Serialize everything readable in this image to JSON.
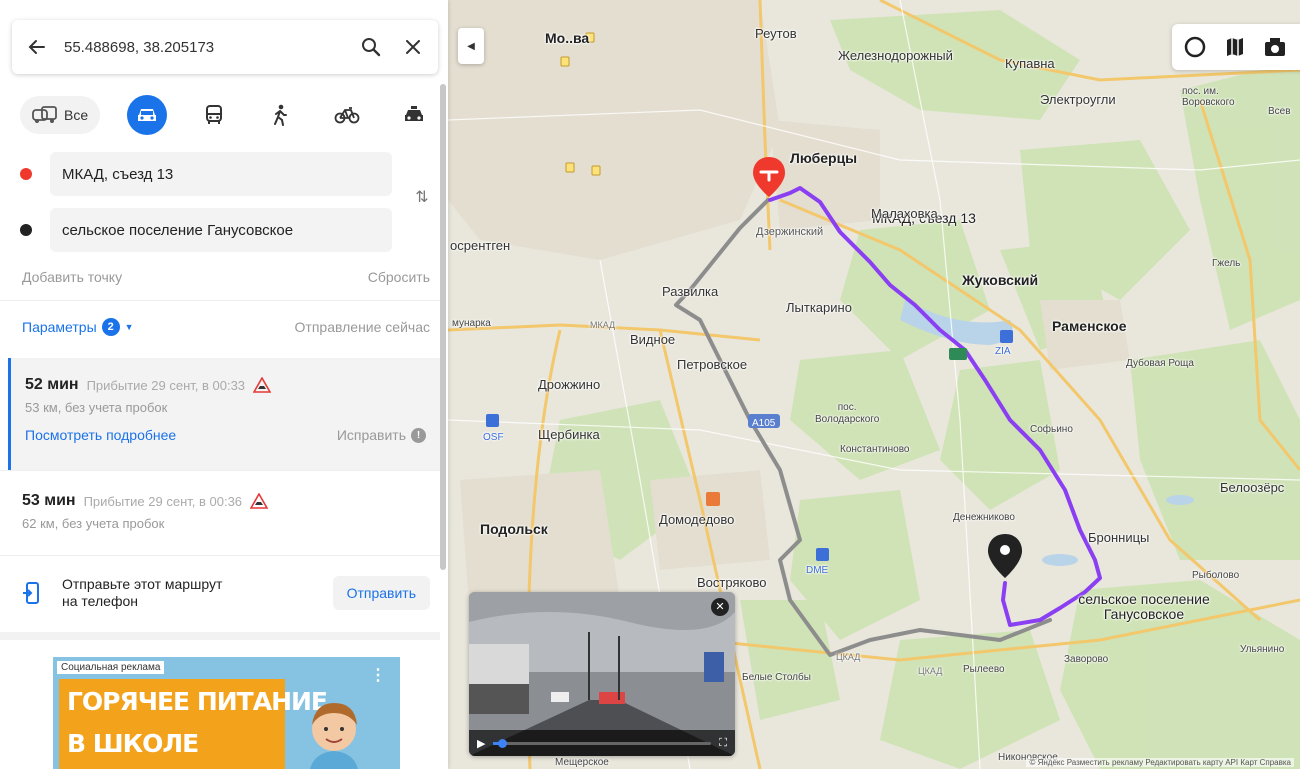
{
  "search": {
    "value": "55.488698, 38.205173"
  },
  "modes": {
    "all_label": "Все"
  },
  "route_points": {
    "from": "МКАД, съезд 13",
    "to": "сельское поселение Ганусовское",
    "add_point": "Добавить точку",
    "reset": "Сбросить"
  },
  "params": {
    "label": "Параметры",
    "count": "2",
    "departure": "Отправление сейчас"
  },
  "routes": [
    {
      "time": "52 мин",
      "arrival": "Прибытие 29 сент, в 00:33",
      "details": "53 км, без учета пробок",
      "more": "Посмотреть подробнее",
      "fix": "Исправить"
    },
    {
      "time": "53 мин",
      "arrival": "Прибытие 29 сент, в 00:36",
      "details": "62 км, без учета пробок"
    }
  ],
  "send": {
    "text_line1": "Отправьте этот маршрут",
    "text_line2": "на телефон",
    "button": "Отправить"
  },
  "ad": {
    "tag": "Социальная реклама",
    "line1": "ГОРЯЧЕЕ ПИТАНИЕ",
    "line2": "В ШКОЛЕ"
  },
  "map": {
    "labels": {
      "moskva": "Мо..ва",
      "reutov": "Реутов",
      "zheleznodorozhny": "Железнодорожный",
      "kupavna": "Купавна",
      "elektrougli": "Электроугли",
      "pos_vorovskogo": "пос. им.\nВоровского",
      "vse": "Всев",
      "lyubertsy": "Люберцы",
      "mkad_exit": "МКАД, съезд 13",
      "dzerzhinsky": "Дзержинский",
      "malakhovka": "Малаховка",
      "rentgen": "осрентген",
      "zhukovsky": "Жуковский",
      "gzhel": "Гжель",
      "razvilka": "Развилка",
      "lytkarino": "Лыткарино",
      "munarka": "мунарка",
      "mkad": "МКАД",
      "vidnoe": "Видное",
      "ramenskoe": "Раменское",
      "petrovskoe": "Петровское",
      "zia": "ZIA",
      "dubovaya_roscha": "Дубовая Роща",
      "drozhzhino": "Дрожжино",
      "pos_volodarskogo": "пос.\nВолодарского",
      "sofyino": "Софьино",
      "osf": "OSF",
      "shcherbinka": "Щербинка",
      "konstantinovo": "Константиново",
      "belozerskiy": "Белоозёрс",
      "domodedovo": "Домодедово",
      "podolsk": "Подольск",
      "denezhnikovo": "Денежниково",
      "bronnitsy": "Бронницы",
      "dme": "DME",
      "vostryakovo": "Востряково",
      "ganusovskoe": "сельское поселение\nГанусовское",
      "ryboloво": "Рыболово",
      "tsad1": "ЦКАД",
      "tsad2": "ЦКАД",
      "ryleevo": "Рылеево",
      "zavorovo": "Заворово",
      "ulyaninо": "Ульянино",
      "belye_stolby": "Белые Столбы",
      "meshcherskoe": "Мещерское",
      "nikonovskoe": "Никоновское",
      "a105": "А105"
    },
    "copyright": "© Яндекс  Разместить рекламу  Редактировать карту  API Карт  Справка"
  },
  "colors": {
    "accent": "#1a73e8",
    "route_main": "#8a3ff2",
    "route_alt": "#8d8d8d",
    "pin_start": "#f0392d",
    "pin_end": "#222222"
  },
  "icons": [
    "back-arrow-icon",
    "search-icon",
    "close-icon",
    "car-icon",
    "bus-icon",
    "walk-icon",
    "bike-icon",
    "taxi-icon",
    "swap-icon",
    "chevron-down-icon",
    "warning-icon",
    "info-icon",
    "phone-icon",
    "layers-icon",
    "traffic-icon",
    "panorama-icon",
    "play-icon",
    "fullscreen-icon"
  ]
}
